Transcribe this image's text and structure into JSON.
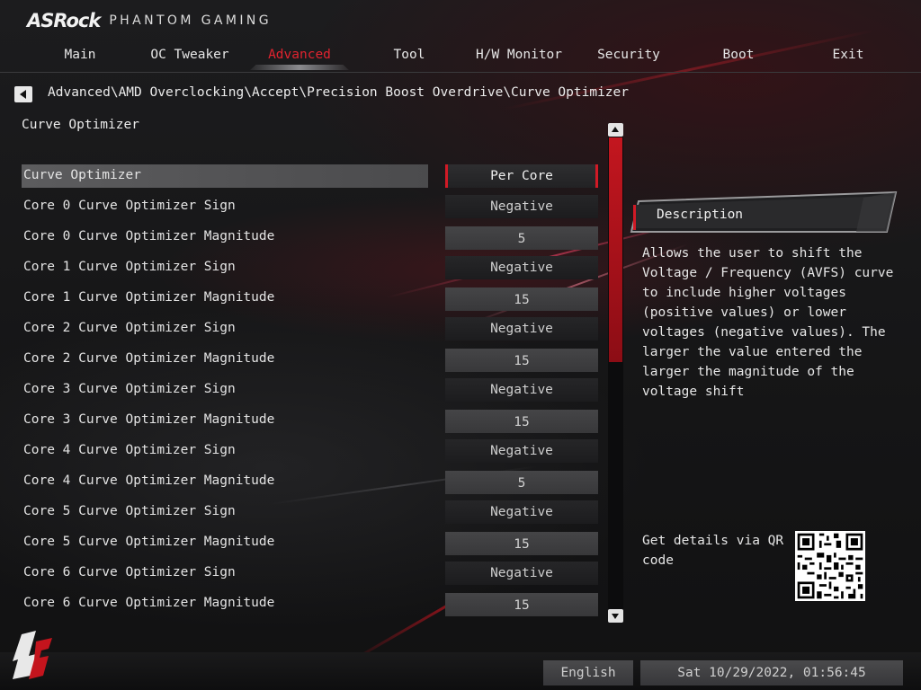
{
  "brand": {
    "name": "ASRock",
    "subtitle": "PHANTOM GAMING"
  },
  "nav": {
    "tabs": [
      {
        "label": "Main"
      },
      {
        "label": "OC Tweaker"
      },
      {
        "label": "Advanced",
        "active": true
      },
      {
        "label": "Tool"
      },
      {
        "label": "H/W Monitor"
      },
      {
        "label": "Security"
      },
      {
        "label": "Boot"
      },
      {
        "label": "Exit"
      }
    ]
  },
  "breadcrumb": "Advanced\\AMD Overclocking\\Accept\\Precision Boost Overdrive\\Curve Optimizer",
  "section_title": "Curve Optimizer",
  "settings": [
    {
      "label": "Curve Optimizer",
      "value": "Per Core"
    },
    {
      "label": "Core 0 Curve Optimizer Sign",
      "value": "Negative"
    },
    {
      "label": "Core 0 Curve Optimizer Magnitude",
      "value": "5"
    },
    {
      "label": "Core 1 Curve Optimizer Sign",
      "value": "Negative"
    },
    {
      "label": "Core 1 Curve Optimizer Magnitude",
      "value": "15"
    },
    {
      "label": "Core 2 Curve Optimizer Sign",
      "value": "Negative"
    },
    {
      "label": "Core 2 Curve Optimizer Magnitude",
      "value": "15"
    },
    {
      "label": "Core 3 Curve Optimizer Sign",
      "value": "Negative"
    },
    {
      "label": "Core 3 Curve Optimizer Magnitude",
      "value": "15"
    },
    {
      "label": "Core 4 Curve Optimizer Sign",
      "value": "Negative"
    },
    {
      "label": "Core 4 Curve Optimizer Magnitude",
      "value": "5"
    },
    {
      "label": "Core 5 Curve Optimizer Sign",
      "value": "Negative"
    },
    {
      "label": "Core 5 Curve Optimizer Magnitude",
      "value": "15"
    },
    {
      "label": "Core 6 Curve Optimizer Sign",
      "value": "Negative"
    },
    {
      "label": "Core 6 Curve Optimizer Magnitude",
      "value": "15"
    }
  ],
  "description": {
    "title": "Description",
    "text": "Allows the user to shift the\nVoltage / Frequency (AVFS) curve\nto include higher voltages\n(positive values) or lower\nvoltages (negative values). The\nlarger the value entered the\nlarger the magnitude of the\nvoltage shift"
  },
  "qr": {
    "text": "Get details via QR code"
  },
  "footer": {
    "language": "English",
    "datetime": "Sat 10/29/2022, 01:56:45"
  },
  "colors": {
    "accent": "#d11a26",
    "active_tab": "#e1232f",
    "row_selected": "#58585a"
  }
}
